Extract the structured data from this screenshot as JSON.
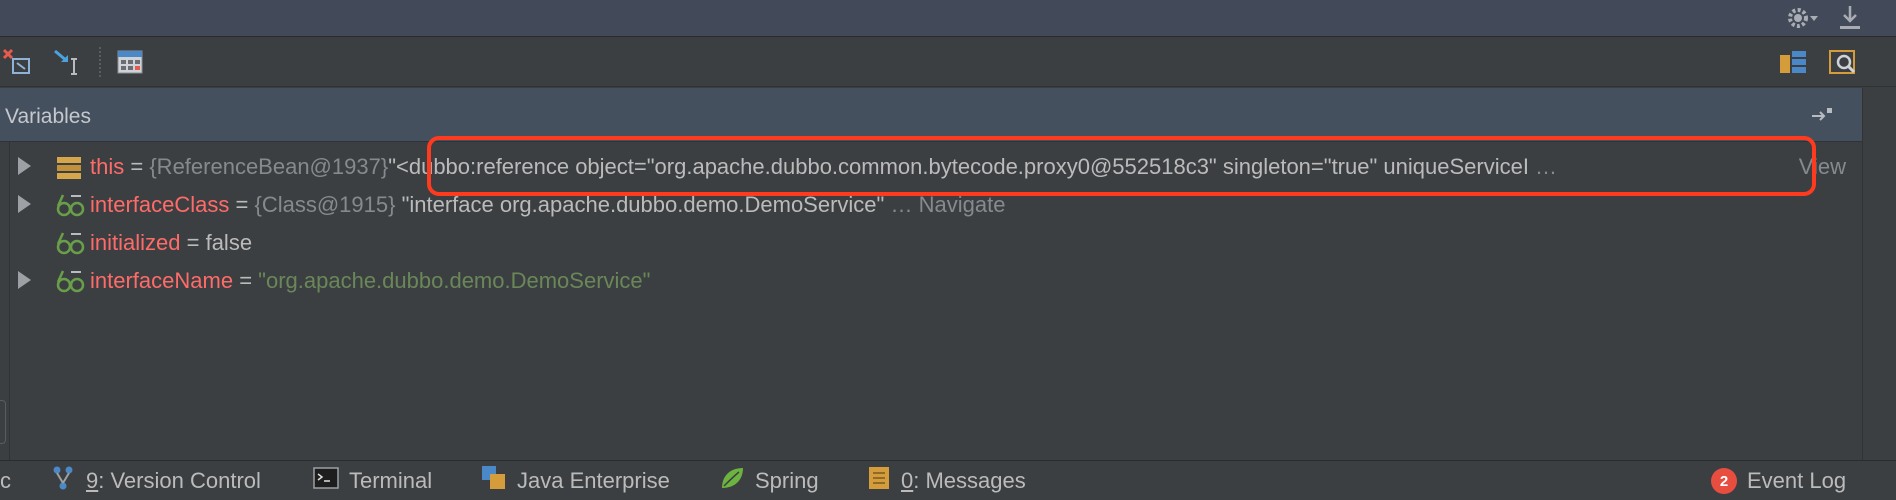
{
  "panel": {
    "title": "Variables"
  },
  "variables": [
    {
      "name": "this",
      "equals": " = ",
      "type_ref": "{ReferenceBean@1937}",
      "value": "\"<dubbo:reference object=\"org.apache.dubbo.common.bytecode.proxy0@552518c3\" singleton=\"true\" uniqueServiceI",
      "ellipsis": " …",
      "action": "View",
      "expandable": true
    },
    {
      "name": "interfaceClass",
      "equals": " = ",
      "type_ref": "{Class@1915}",
      "value": " \"interface org.apache.dubbo.demo.DemoService\"",
      "ellipsis": " …",
      "action": "Navigate",
      "expandable": true
    },
    {
      "name": "initialized",
      "equals": " = ",
      "value": "false",
      "expandable": false
    },
    {
      "name": "interfaceName",
      "equals": " = ",
      "value": "\"org.apache.dubbo.demo.DemoService\"",
      "expandable": true
    }
  ],
  "bottom_tabs": {
    "partial": "c",
    "version_control": {
      "mnemonic": "9",
      "label": ": Version Control"
    },
    "terminal": {
      "label": "Terminal"
    },
    "java_enterprise": {
      "label": "Java Enterprise"
    },
    "spring": {
      "label": "Spring"
    },
    "messages": {
      "mnemonic": "0",
      "label": ": Messages"
    },
    "event_log": {
      "badge": "2",
      "label": "Event Log"
    }
  },
  "colors": {
    "accent_highlight": "#ff3b1f",
    "variable_name": "#ff6b68",
    "string_green": "#6a8759",
    "badge": "#e84e40"
  },
  "icons": [
    "settings-gear-icon",
    "download-icon",
    "remove-watch-icon",
    "step-into-icon",
    "evaluate-expression-icon",
    "restore-layout-icon",
    "inspect-icon",
    "pin-icon",
    "field-icon",
    "watch-glasses-icon",
    "version-control-icon",
    "terminal-icon",
    "java-enterprise-icon",
    "spring-icon",
    "messages-icon"
  ]
}
